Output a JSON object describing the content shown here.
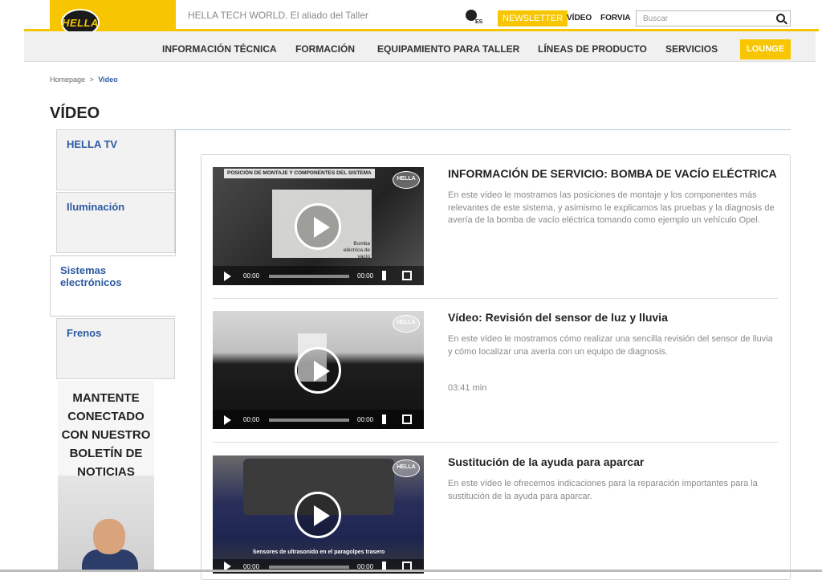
{
  "header": {
    "logo_text": "HELLA",
    "tagline": "HELLA TECH WORLD. El aliado del Taller",
    "lang": "ES",
    "newsletter": "NEWSLETTER",
    "video_link": "VÍDEO",
    "forvia_link": "FORVIA",
    "search_placeholder": "Buscar"
  },
  "nav": {
    "items": [
      "INFORMACIÓN TÉCNICA",
      "FORMACIÓN",
      "EQUIPAMIENTO PARA TALLER",
      "LÍNEAS DE PRODUCTO",
      "SERVICIOS"
    ],
    "lounge": "LOUNGE"
  },
  "breadcrumb": {
    "home": "Homepage",
    "sep": ">",
    "current": "Video"
  },
  "page_title": "VÍDEO",
  "sidebar": {
    "tabs": [
      "HELLA TV",
      "Iluminación",
      "Sistemas electrónicos",
      "Frenos"
    ],
    "active_index": 2,
    "promo": "MANTENTE CONECTADO CON NUESTRO BOLETÍN DE NOTICIAS"
  },
  "videos": [
    {
      "title": "INFORMACIÓN DE SERVICIO: BOMBA DE VACÍO ELÉCTRICA",
      "description": "En este vídeo le mostramos las posiciones de montaje y los componentes más relevantes de este sistema, y asimismo le explicamos las pruebas y la diagnosis de avería de la bomba de vacío eléctrica tomando como ejemplo un vehículo Opel.",
      "duration": "",
      "caption_top": "POSICIÓN DE MONTAJE Y COMPONENTES DEL SISTEMA",
      "caption_mid": "Bomba eléctrica de vacío",
      "time_start": "00:00",
      "time_end": "00:00"
    },
    {
      "title": "Vídeo: Revisión del sensor de luz y lluvia",
      "description": "En este vídeo le mostramos cómo realizar una sencilla revisión del sensor de lluvia y cómo localizar una avería con un equipo de diagnosis.",
      "duration": "03:41 min",
      "caption_top": "",
      "caption_mid": "",
      "time_start": "00:00",
      "time_end": "00:00"
    },
    {
      "title": "Sustitución de la ayuda para aparcar",
      "description": "En este vídeo le ofrecemos indicaciones para la reparación importantes para la sustitución de la ayuda para aparcar.",
      "duration": "",
      "caption_top": "",
      "caption_mid": "Sensores de ultrasonido en el paragolpes trasero",
      "time_start": "00:00",
      "time_end": "00:00"
    }
  ],
  "colors": {
    "brand_yellow": "#f7c600",
    "link_blue": "#2d5aa0"
  }
}
